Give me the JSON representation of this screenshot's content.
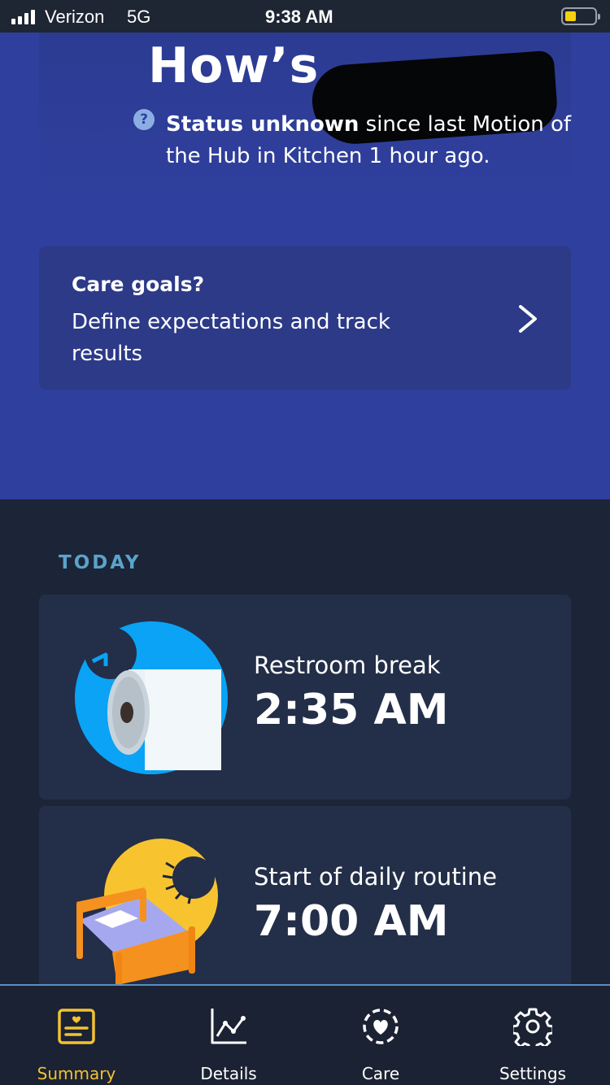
{
  "status_bar": {
    "carrier": "Verizon",
    "network": "5G",
    "time": "9:38 AM",
    "battery_color": "#f5d20f"
  },
  "hero": {
    "greeting": "How’s",
    "status": {
      "icon": "question-circle-icon",
      "bold": "Status unknown",
      "rest": " since last Motion of the Hub in Kitchen 1 hour ago."
    }
  },
  "care_goals": {
    "title": "Care goals?",
    "description": "Define expectations and track results",
    "icon": "chevron-right-icon"
  },
  "today": {
    "label": "TODAY",
    "events": [
      {
        "title": "Restroom break",
        "time": "2:35 AM",
        "icon": "toilet-paper-clock-icon"
      },
      {
        "title": "Start of daily routine",
        "time": "7:00 AM",
        "icon": "bed-sunrise-icon"
      }
    ]
  },
  "tabs": [
    {
      "label": "Summary",
      "icon": "summary-card-icon",
      "active": true
    },
    {
      "label": "Details",
      "icon": "line-chart-icon",
      "active": false
    },
    {
      "label": "Care",
      "icon": "heart-circle-icon",
      "active": false
    },
    {
      "label": "Settings",
      "icon": "gear-icon",
      "active": false
    }
  ],
  "colors": {
    "hero_bg": "#2f3f9d",
    "page_bg": "#1c2438",
    "card_bg": "#232e48",
    "accent_tab": "#f2c231",
    "today_label": "#5ba3c9"
  }
}
